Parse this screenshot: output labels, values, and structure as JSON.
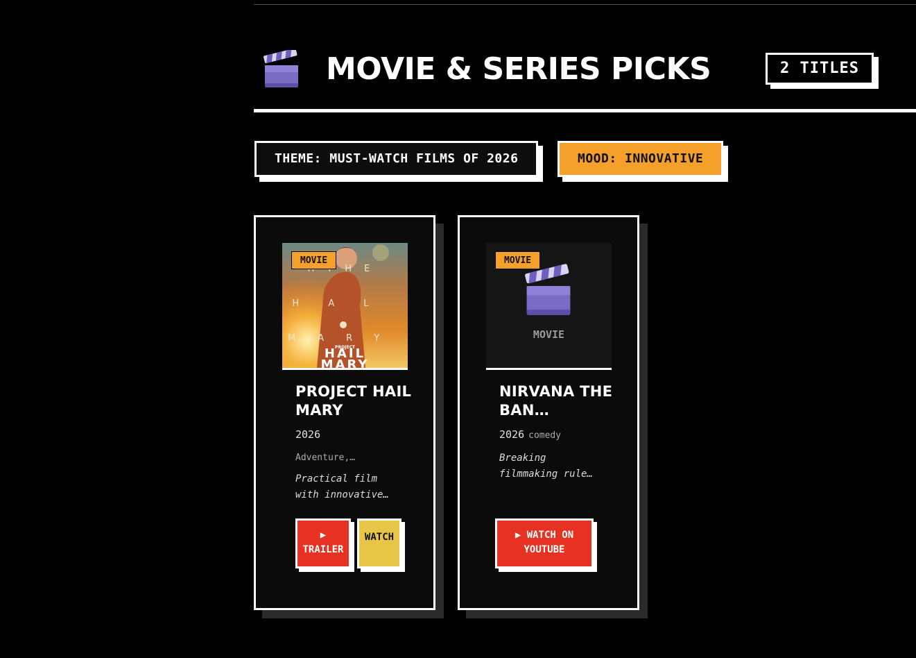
{
  "header": {
    "title": "MOVIE & SERIES PICKS",
    "count_badge": "2 TITLES"
  },
  "filters": {
    "theme": "THEME: MUST-WATCH FILMS OF 2026",
    "mood": "MOOD: INNOVATIVE"
  },
  "cards": [
    {
      "type_tag": "MOVIE",
      "poster_text": [
        "H",
        "THE",
        "H",
        "A",
        "L",
        "M",
        "A",
        "R",
        "Y",
        "PROJECT",
        "HAIL",
        "MARY"
      ],
      "title": "PROJECT HAIL MARY",
      "year": "2026",
      "genre": "Adventure,…",
      "description": "Practical film with innovative…",
      "trailer_button": "▶ TRAILER",
      "watch_button": "WATCH"
    },
    {
      "type_tag": "MOVIE",
      "placeholder_label": "MOVIE",
      "title": "NIRVANA THE BAN…",
      "year": "2026",
      "genre": "comedy",
      "description": "Breaking filmmaking rule…",
      "youtube_button": "▶ WATCH ON YOUTUBE"
    }
  ],
  "colors": {
    "background": "#000000",
    "accent_orange": "#f5a02a",
    "button_red": "#e63222",
    "button_yellow": "#e8c547"
  },
  "icons": {
    "header_icon": "clapperboard-icon"
  }
}
